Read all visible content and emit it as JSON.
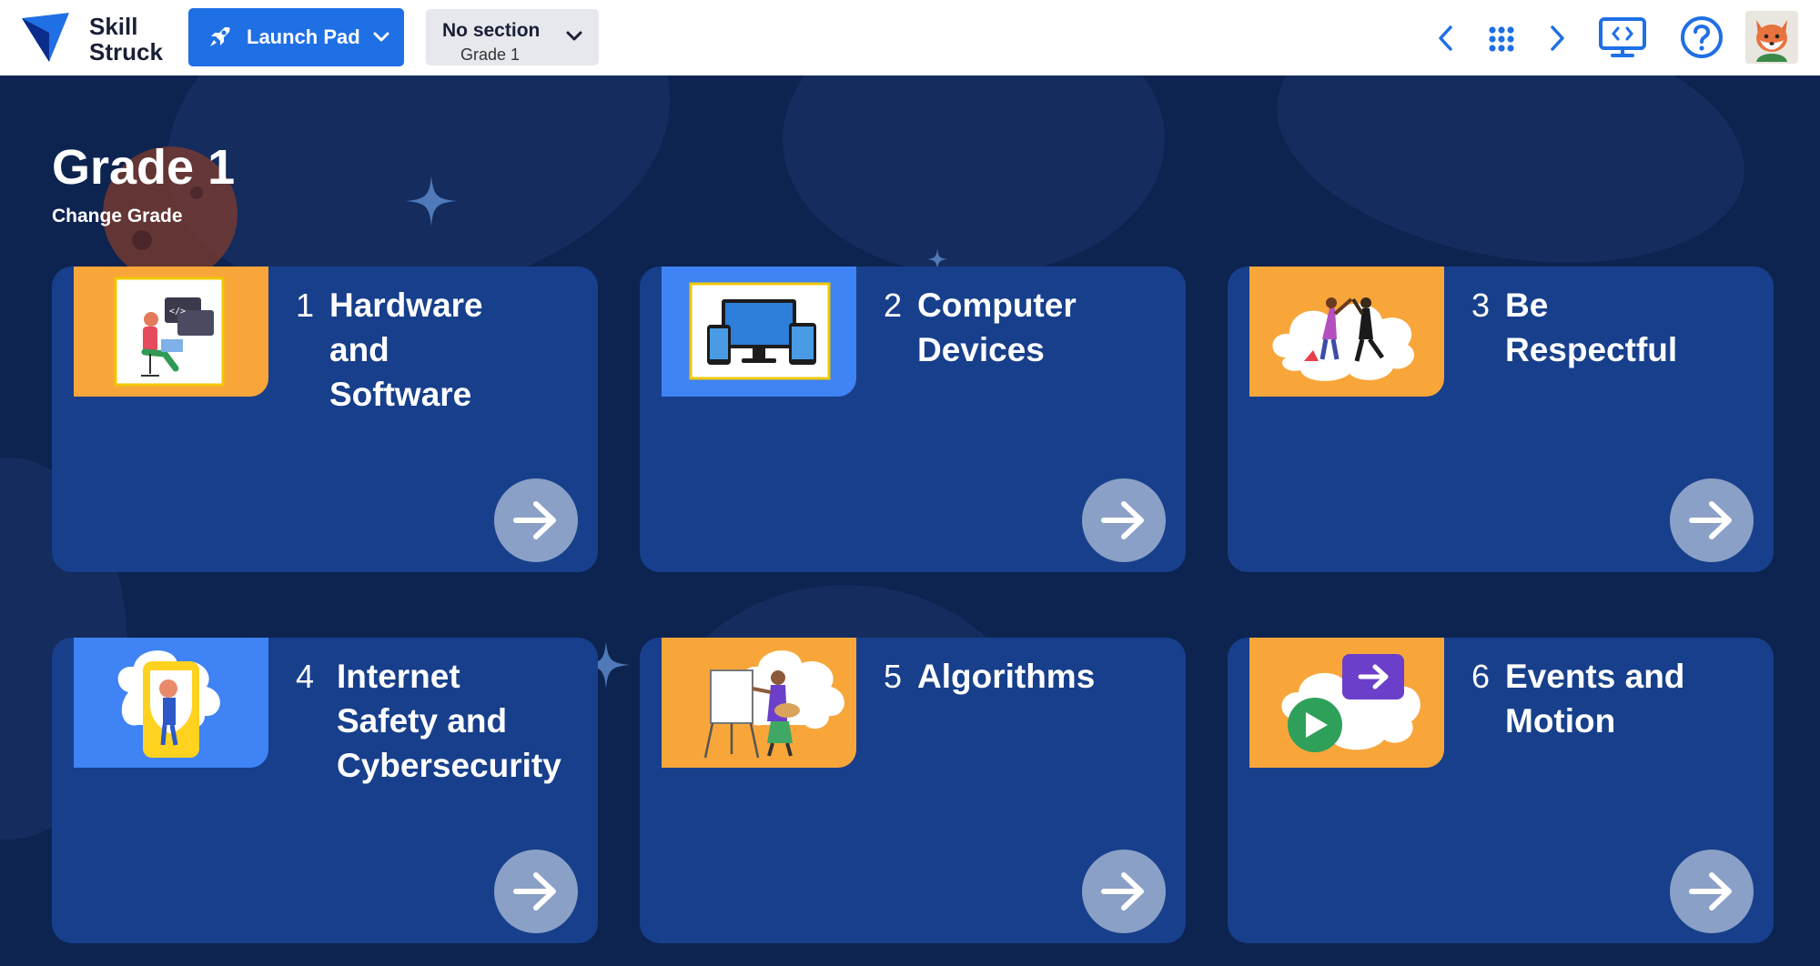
{
  "app": {
    "logo_line1": "Skill",
    "logo_line2": "Struck"
  },
  "topbar": {
    "launchpad_label": "Launch Pad",
    "section_label": "No section",
    "section_grade": "Grade 1",
    "icons": [
      "rocket-icon",
      "chevron-down-icon",
      "chevron-left-icon",
      "apps-grid-icon",
      "chevron-right-icon",
      "present-screen-icon",
      "help-icon",
      "fox-avatar"
    ]
  },
  "page": {
    "title": "Grade 1",
    "change_grade": "Change Grade"
  },
  "colors": {
    "background": "#0d2350",
    "card": "#173f8b",
    "accent_blue": "#1f6fe5",
    "thumb_orange": "#f8a63a",
    "thumb_blue": "#3f83f4",
    "arrow_button": "#8aa0c6"
  },
  "cards": [
    {
      "number": "1",
      "title_lines": [
        "Hardware",
        "and",
        "Software"
      ],
      "thumb_color": "orange",
      "icon": "person-computer-icon"
    },
    {
      "number": "2",
      "title_lines": [
        "Computer",
        "Devices"
      ],
      "thumb_color": "blue",
      "icon": "devices-icon"
    },
    {
      "number": "3",
      "title_lines": [
        "Be",
        "Respectful"
      ],
      "thumb_color": "orange",
      "icon": "high-five-icon"
    },
    {
      "number": "4",
      "title_lines": [
        "Internet",
        "Safety and",
        "Cybersecurity"
      ],
      "thumb_color": "blue",
      "icon": "internet-safety-icon"
    },
    {
      "number": "5",
      "title_lines": [
        "Algorithms"
      ],
      "thumb_color": "orange",
      "icon": "painter-easel-icon"
    },
    {
      "number": "6",
      "title_lines": [
        "Events and",
        "Motion"
      ],
      "thumb_color": "orange",
      "icon": "events-motion-icon"
    }
  ]
}
